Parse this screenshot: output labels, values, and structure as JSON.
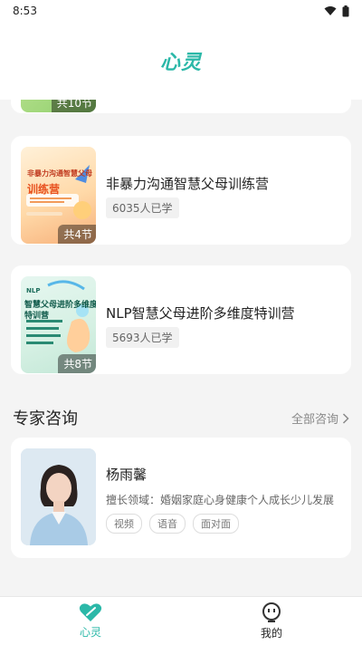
{
  "status_bar": {
    "time": "8:53"
  },
  "header": {
    "title": "心灵"
  },
  "courses": [
    {
      "title": "",
      "badge": "共10节",
      "learners": ""
    },
    {
      "title": "非暴力沟通智慧父母训练营",
      "badge": "共4节",
      "learners": "6035人已学",
      "cover_title_line1": "非暴力沟通智慧父母",
      "cover_title_line2": "训练营"
    },
    {
      "title": "NLP智慧父母进阶多维度特训营",
      "badge": "共8节",
      "learners": "5693人已学",
      "cover_small": "NLP",
      "cover_title_line1": "智慧父母进阶多维度",
      "cover_title_line2": "特训营"
    }
  ],
  "experts_section": {
    "title": "专家咨询",
    "view_all": "全部咨询"
  },
  "expert": {
    "name": "杨雨馨",
    "field": "擅长领域：婚姻家庭心身健康个人成长少儿发展",
    "tags": [
      "视频",
      "语音",
      "面对面"
    ]
  },
  "tabbar": {
    "tabs": [
      {
        "label": "心灵",
        "active": true
      },
      {
        "label": "我的",
        "active": false
      }
    ]
  },
  "colors": {
    "accent": "#2bb8a8"
  }
}
